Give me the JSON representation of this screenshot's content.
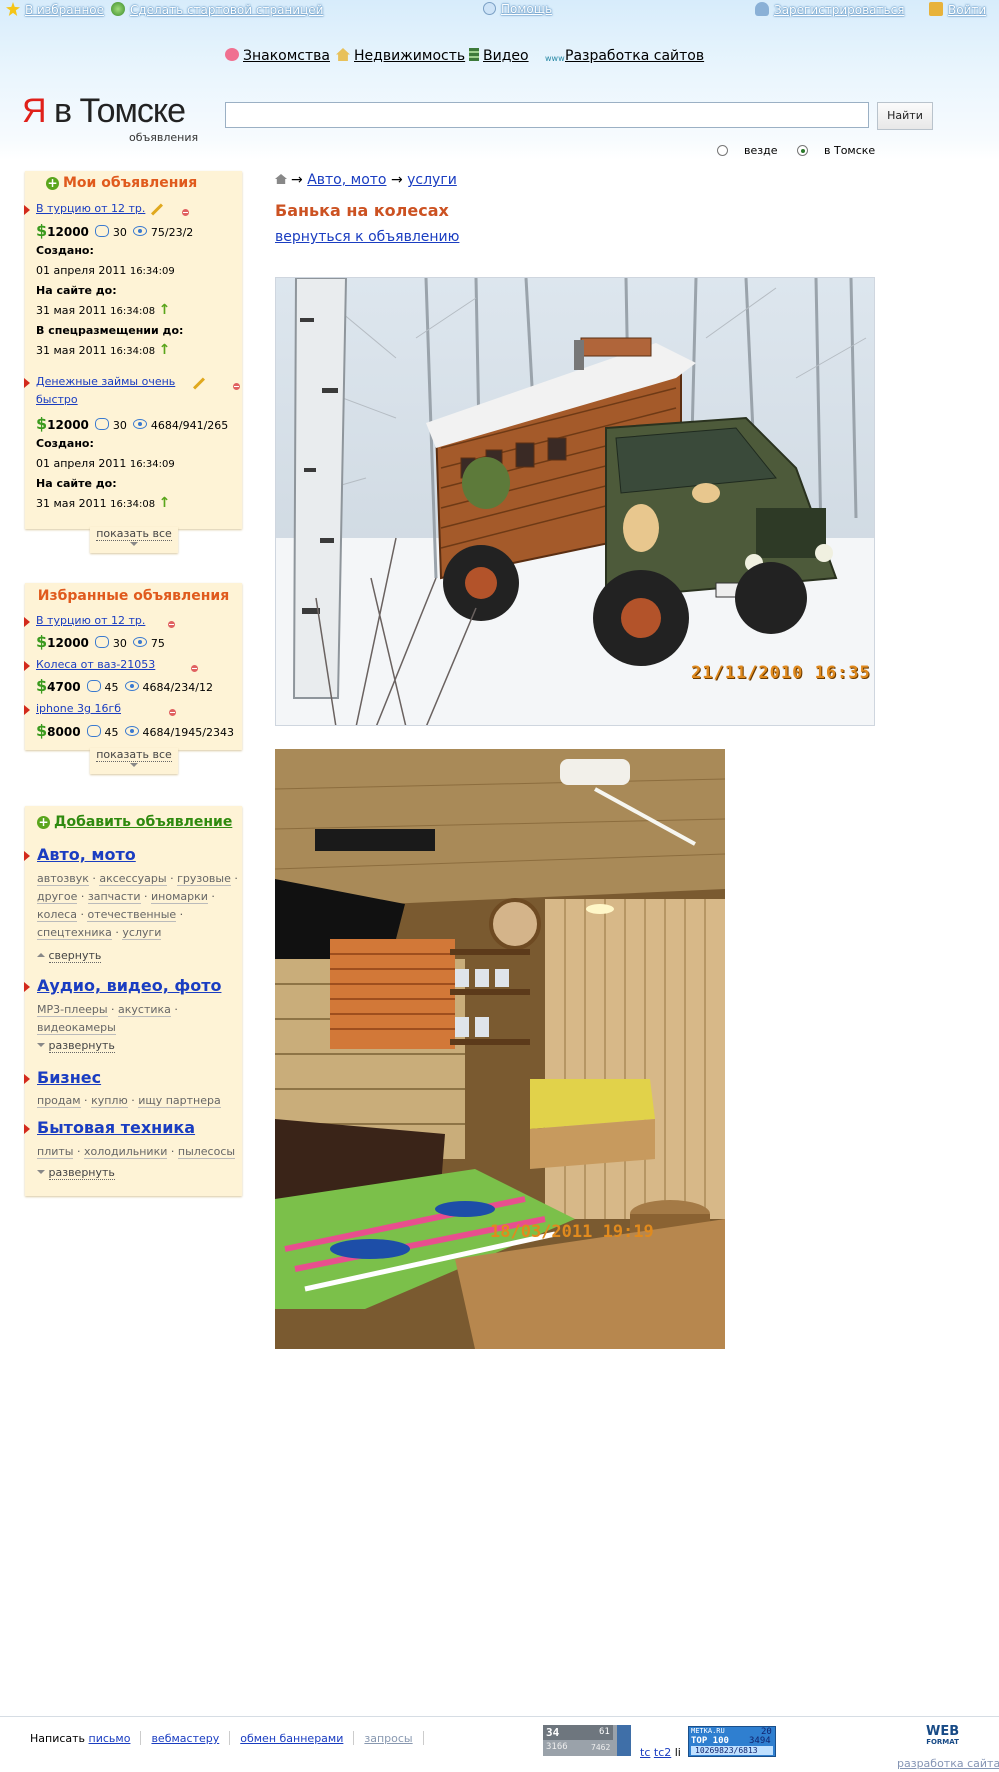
{
  "topbar": {
    "favorites": "В избранное",
    "make_start": "Сделать стартовой страницей",
    "help": "Помощь",
    "register": "Зарегистрироваться",
    "login": "Войти"
  },
  "nav": {
    "items": [
      "Знакомства",
      "Недвижимость",
      "Видео",
      "Разработка сайтов"
    ]
  },
  "logo": {
    "ya": "Я",
    "rest": " в Томске",
    "sub": "объявления"
  },
  "search": {
    "value": "",
    "button": "Найти",
    "radio_everywhere": "везде",
    "radio_tomsk": "в Томске",
    "selected": "в Томске"
  },
  "my_ads": {
    "title": "Мои объявления",
    "ads": [
      {
        "title": "В турцию от 12 тр.",
        "price": "12000",
        "comments": "30",
        "views": "75/23/2",
        "created_label": "Создано:",
        "created": "01 апреля 2011",
        "created_time": "16:34:09",
        "until_label": "На сайте до:",
        "until": "31 мая 2011",
        "until_time": "16:34:08",
        "special_label": "В спецразмещении до:",
        "special": "31 мая 2011",
        "special_time": "16:34:08"
      },
      {
        "title_line1": "Денежные займы очень",
        "title_line2": "быстро",
        "price": "12000",
        "comments": "30",
        "views": "4684/941/265",
        "created_label": "Создано:",
        "created": "01 апреля 2011",
        "created_time": "16:34:09",
        "until_label": "На сайте до:",
        "until": "31 мая 2011",
        "until_time": "16:34:08"
      }
    ],
    "show_all": "показать все"
  },
  "fav_ads": {
    "title": "Избранные объявления",
    "ads": [
      {
        "title": "В турцию от 12 тр.",
        "price": "12000",
        "comments": "30",
        "views": "75"
      },
      {
        "title": "Колеса от ваз-21053",
        "price": "4700",
        "comments": "45",
        "views": "4684/234/12"
      },
      {
        "title": "iphone 3g 16гб",
        "price": "8000",
        "comments": "45",
        "views": "4684/1945/2343"
      }
    ],
    "show_all": "показать все"
  },
  "add_block": {
    "title": "Добавить объявление",
    "categories": [
      {
        "name": "Авто, мото",
        "subs_line1": [
          "автозвук",
          "аксессуары",
          "грузовые"
        ],
        "subs_line2": [
          "другое",
          "запчасти",
          "иномарки"
        ],
        "subs_line3": [
          "колеса",
          "отечественные"
        ],
        "subs_line4": [
          "спецтехника",
          "услуги"
        ],
        "toggle": "свернуть"
      },
      {
        "name": "Аудио, видео, фото",
        "subs_line1": [
          "MP3-плееры",
          "акустика"
        ],
        "subs_line2": [
          "видеокамеры"
        ],
        "toggle": "развернуть"
      },
      {
        "name": "Бизнес",
        "subs_line1": [
          "продам",
          "куплю",
          "ищу партнера"
        ]
      },
      {
        "name": "Бытовая техника",
        "subs_line1": [
          "плиты",
          "холодильники",
          "пылесосы"
        ],
        "toggle": "развернуть"
      }
    ]
  },
  "main": {
    "breadcrumb_sep": "→",
    "crumb1": "Авто, мото",
    "crumb2": "услуги",
    "title": "Банька на колесах",
    "back": "вернуться к объявлению",
    "photo1_stamp": "21/11/2010 16:35",
    "photo2_stamp": "18/03/2011 19:19"
  },
  "footer": {
    "write": "Написать",
    "letter": "письмо",
    "webmaster": "вебмастеру",
    "banners": "обмен баннерами",
    "requests": "запросы",
    "counter1_a": "34",
    "counter1_b": "61",
    "counter1_c": "3166",
    "counter1_d": "7462",
    "tc": "tc",
    "tc2": "tc2",
    "li": "li",
    "metka_title": "METKA.RU",
    "metka_a": "20",
    "metka_top": "TOP 100",
    "metka_b": "3494",
    "metka_c": "10269823/6813",
    "webformat_line1": "WEB",
    "webformat_line2": "FORMAT",
    "dev": "разработка сайта"
  }
}
